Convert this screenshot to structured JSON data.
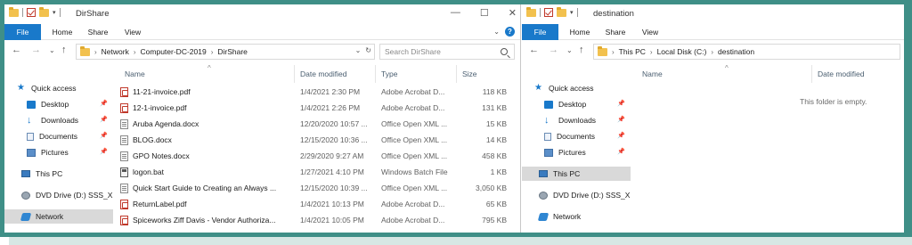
{
  "colors": {
    "frame_border": "#3f8f87",
    "ribbon_file_tab": "#1979ca",
    "selected_nav": "#d9d9d9",
    "column_header_text": "#4a5e70"
  },
  "left_window": {
    "title": "DirShare",
    "ribbon": {
      "file": "File",
      "home": "Home",
      "share": "Share",
      "view": "View"
    },
    "address": {
      "crumbs": [
        "Network",
        "Computer-DC-2019",
        "DirShare"
      ]
    },
    "search": {
      "placeholder": "Search DirShare"
    },
    "columns": {
      "name": "Name",
      "date": "Date modified",
      "type": "Type",
      "size": "Size"
    },
    "nav": {
      "quick_access": "Quick access",
      "desktop": "Desktop",
      "downloads": "Downloads",
      "documents": "Documents",
      "pictures": "Pictures",
      "this_pc": "This PC",
      "dvd": "DVD Drive (D:) SSS_X",
      "network": "Network"
    },
    "files": [
      {
        "name": "11-21-invoice.pdf",
        "date": "1/4/2021 2:30 PM",
        "type": "Adobe Acrobat D...",
        "size": "118 KB",
        "icon": "pdf-icon"
      },
      {
        "name": "12-1-invoice.pdf",
        "date": "1/4/2021 2:26 PM",
        "type": "Adobe Acrobat D...",
        "size": "131 KB",
        "icon": "pdf-icon"
      },
      {
        "name": "Aruba Agenda.docx",
        "date": "12/20/2020 10:57 ...",
        "type": "Office Open XML ...",
        "size": "15 KB",
        "icon": "doc-icon"
      },
      {
        "name": "BLOG.docx",
        "date": "12/15/2020 10:36 ...",
        "type": "Office Open XML ...",
        "size": "14 KB",
        "icon": "doc-icon"
      },
      {
        "name": "GPO Notes.docx",
        "date": "2/29/2020 9:27 AM",
        "type": "Office Open XML ...",
        "size": "458 KB",
        "icon": "doc-icon"
      },
      {
        "name": "logon.bat",
        "date": "1/27/2021 4:10 PM",
        "type": "Windows Batch File",
        "size": "1 KB",
        "icon": "bat-icon"
      },
      {
        "name": "Quick Start Guide to Creating an Always ...",
        "date": "12/15/2020 10:39 ...",
        "type": "Office Open XML ...",
        "size": "3,050 KB",
        "icon": "doc-icon"
      },
      {
        "name": "ReturnLabel.pdf",
        "date": "1/4/2021 10:13 PM",
        "type": "Adobe Acrobat D...",
        "size": "65 KB",
        "icon": "pdf-icon"
      },
      {
        "name": "Spiceworks Ziff Davis - Vendor Authoriza...",
        "date": "1/4/2021 10:05 PM",
        "type": "Adobe Acrobat D...",
        "size": "795 KB",
        "icon": "pdf-icon"
      }
    ]
  },
  "right_window": {
    "title": "destination",
    "ribbon": {
      "file": "File",
      "home": "Home",
      "share": "Share",
      "view": "View"
    },
    "address": {
      "crumbs": [
        "This PC",
        "Local Disk (C:)",
        "destination"
      ]
    },
    "columns": {
      "name": "Name",
      "date": "Date modified"
    },
    "nav": {
      "quick_access": "Quick access",
      "desktop": "Desktop",
      "downloads": "Downloads",
      "documents": "Documents",
      "pictures": "Pictures",
      "this_pc": "This PC",
      "dvd": "DVD Drive (D:) SSS_X",
      "network": "Network"
    },
    "empty_message": "This folder is empty."
  }
}
